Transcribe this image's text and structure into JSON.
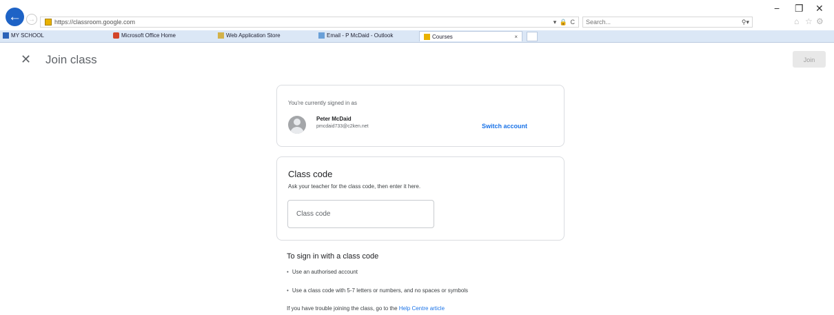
{
  "browser": {
    "url": "https://classroom.google.com",
    "search_placeholder": "Search...",
    "address_controls": "▾ 🔒 C",
    "search_icon": "search-icon",
    "favorites": [
      {
        "label": "MY SCHOOL",
        "icon_color": "#2a62b8"
      },
      {
        "label": "Microsoft Office Home",
        "icon_color": "#d2452a"
      },
      {
        "label": "Web Application Store",
        "icon_color": "#d3b24a"
      },
      {
        "label": "Email - P McDaid - Outlook",
        "icon_color": "#6aa0d8"
      }
    ],
    "tabs": [
      {
        "label": "Courses",
        "active": true,
        "icon_color": "#e9b200"
      }
    ],
    "window_controls": [
      "−",
      "❐",
      "✕"
    ],
    "toolbar_icons": [
      "home-icon",
      "star-icon",
      "gear-icon"
    ]
  },
  "header": {
    "close_icon": "close-icon",
    "title": "Join class",
    "join_button": "Join"
  },
  "account_card": {
    "signed_in_text": "You're currently signed in as",
    "user_name": "Peter McDaid",
    "user_email": "pmcdaid733@c2ken.net",
    "switch_button": "Switch account"
  },
  "class_code_card": {
    "title": "Class code",
    "description": "Ask your teacher for the class code, then enter it here.",
    "input_placeholder": "Class code"
  },
  "info": {
    "title": "To sign in with a class code",
    "bullets": [
      "Use an authorised account",
      "Use a class code with 5-7 letters or numbers, and no spaces or symbols"
    ],
    "help_prefix": "If you have trouble joining the class, go to the ",
    "help_link": "Help Centre article"
  },
  "colors": {
    "accent": "#1a73e8",
    "back_button": "#1e63c6",
    "favbar": "#dbe7f6"
  }
}
